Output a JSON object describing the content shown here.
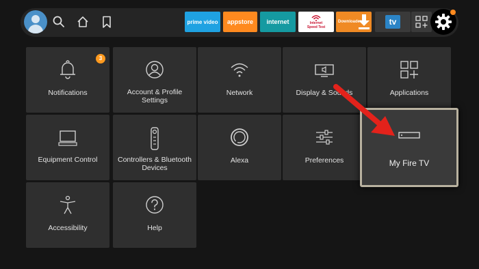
{
  "topbar": {
    "apps": [
      {
        "label": "prime video"
      },
      {
        "label": "appstore"
      },
      {
        "label": "internet"
      },
      {
        "label": "Internet Speed Test"
      },
      {
        "label": "Downloader"
      },
      {
        "label": "tv"
      }
    ]
  },
  "tiles": [
    {
      "label": "Notifications",
      "badge": "3"
    },
    {
      "label": "Account & Profile Settings"
    },
    {
      "label": "Network"
    },
    {
      "label": "Display & Sounds"
    },
    {
      "label": "Applications"
    },
    {
      "label": "Equipment Control"
    },
    {
      "label": "Controllers & Bluetooth Devices"
    },
    {
      "label": "Alexa"
    },
    {
      "label": "Preferences"
    },
    {
      "label": "My Fire TV"
    },
    {
      "label": "Accessibility"
    },
    {
      "label": "Help"
    }
  ],
  "colors": {
    "accent": "#ff8a1f",
    "arrow": "#e3221b",
    "focus_border": "#b9b2a0"
  }
}
